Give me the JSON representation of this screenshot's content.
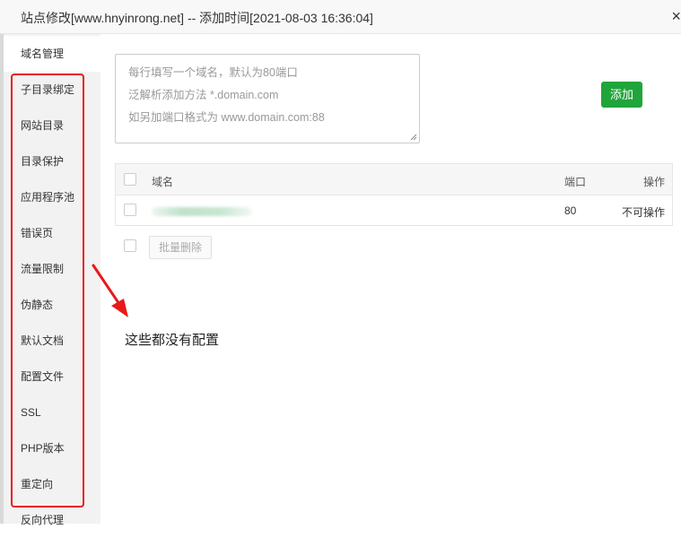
{
  "window": {
    "title": "站点修改[www.hnyinrong.net] -- 添加时间[2021-08-03 16:36:04]",
    "close_label": "×"
  },
  "sidebar": {
    "items": [
      {
        "label": "域名管理",
        "active": true
      },
      {
        "label": "子目录绑定",
        "active": false
      },
      {
        "label": "网站目录",
        "active": false
      },
      {
        "label": "目录保护",
        "active": false
      },
      {
        "label": "应用程序池",
        "active": false
      },
      {
        "label": "错误页",
        "active": false
      },
      {
        "label": "流量限制",
        "active": false
      },
      {
        "label": "伪静态",
        "active": false
      },
      {
        "label": "默认文档",
        "active": false
      },
      {
        "label": "配置文件",
        "active": false
      },
      {
        "label": "SSL",
        "active": false
      },
      {
        "label": "PHP版本",
        "active": false
      },
      {
        "label": "重定向",
        "active": false
      },
      {
        "label": "反向代理",
        "active": false
      }
    ]
  },
  "domain_input": {
    "placeholder_lines": [
      "每行填写一个域名，默认为80端口",
      "泛解析添加方法 *.domain.com",
      "如另加端口格式为 www.domain.com:88"
    ],
    "value": ""
  },
  "add_button": {
    "label": "添加",
    "color": "#20a53a"
  },
  "table": {
    "headers": {
      "domain": "域名",
      "port": "端口",
      "action": "操作"
    },
    "rows": [
      {
        "domain": "",
        "domain_redacted": true,
        "port": "80",
        "action": "不可操作"
      }
    ]
  },
  "batch_delete": {
    "label": "批量删除"
  },
  "annotation": {
    "text": "这些都没有配置",
    "color": "#e8191a"
  }
}
